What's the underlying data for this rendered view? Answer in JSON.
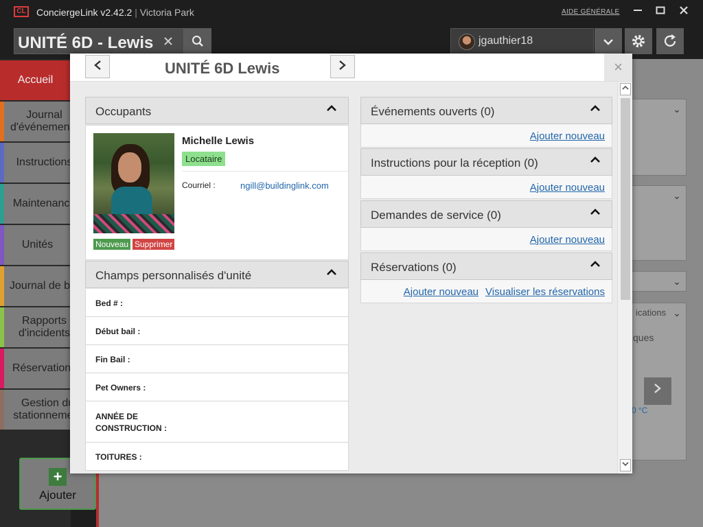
{
  "titlebar": {
    "logo": "CL",
    "app_name": "ConciergeLink v2.42.2",
    "separator": "|",
    "site_name": "Victoria Park",
    "help_label": "AIDE GÉNÉRALE",
    "minimize": "—",
    "maximize": "□",
    "close": "✕"
  },
  "header": {
    "unit_search_value": "UNITÉ 6D - Lewis",
    "clear_icon": "✕",
    "search_icon": "search-icon",
    "username": "jgauthier18",
    "dropdown_icon": "chevron-down-icon",
    "settings_icon": "gear-icon",
    "refresh_icon": "refresh-icon"
  },
  "nav": {
    "items": [
      {
        "label": "Accueil",
        "color": "#b92c2c",
        "active": true
      },
      {
        "label": "Journal d'événements",
        "color": "#e07020"
      },
      {
        "label": "Instructions",
        "color": "#5c6bc0"
      },
      {
        "label": "Maintenance",
        "color": "#2e9e8e"
      },
      {
        "label": "Unités",
        "color": "#7e57c2"
      },
      {
        "label": "Journal de bord",
        "color": "#e0a030"
      },
      {
        "label": "Rapports d'incidents",
        "color": "#8bc34a"
      },
      {
        "label": "Réservations",
        "color": "#d81b60"
      },
      {
        "label": "Gestion du stationnement",
        "color": "#8d6e63"
      }
    ],
    "add_label": "Ajouter",
    "add_icon": "+"
  },
  "background": {
    "visible_text_1": "ications",
    "visible_text_2": "ques",
    "visible_text_3": "0 °C"
  },
  "modal": {
    "title": "UNITÉ 6D Lewis",
    "prev_icon": "chevron-left-icon",
    "next_icon": "chevron-right-icon",
    "close_icon": "×",
    "occupants": {
      "header": "Occupants",
      "name": "Michelle Lewis",
      "role_badge": "Locataire",
      "email_label": "Courriel :",
      "email_value": "ngill@buildinglink.com",
      "new_button": "Nouveau",
      "delete_button": "Supprimer"
    },
    "custom_fields": {
      "header": "Champs personnalisés d'unité",
      "rows": [
        "Bed # :",
        "Début bail :",
        "Fin Bail :",
        "Pet Owners :",
        "ANNÉE DE CONSTRUCTION :",
        "TOITURES :"
      ]
    },
    "events": {
      "header": "Événements ouverts (0)",
      "add": "Ajouter nouveau"
    },
    "instructions": {
      "header": "Instructions pour la réception (0)",
      "add": "Ajouter nouveau"
    },
    "service": {
      "header": "Demandes de service (0)",
      "add": "Ajouter nouveau"
    },
    "reservations": {
      "header": "Réservations (0)",
      "add": "Ajouter nouveau",
      "view": "Visualiser les réservations"
    },
    "chevron_up": "⌃"
  }
}
